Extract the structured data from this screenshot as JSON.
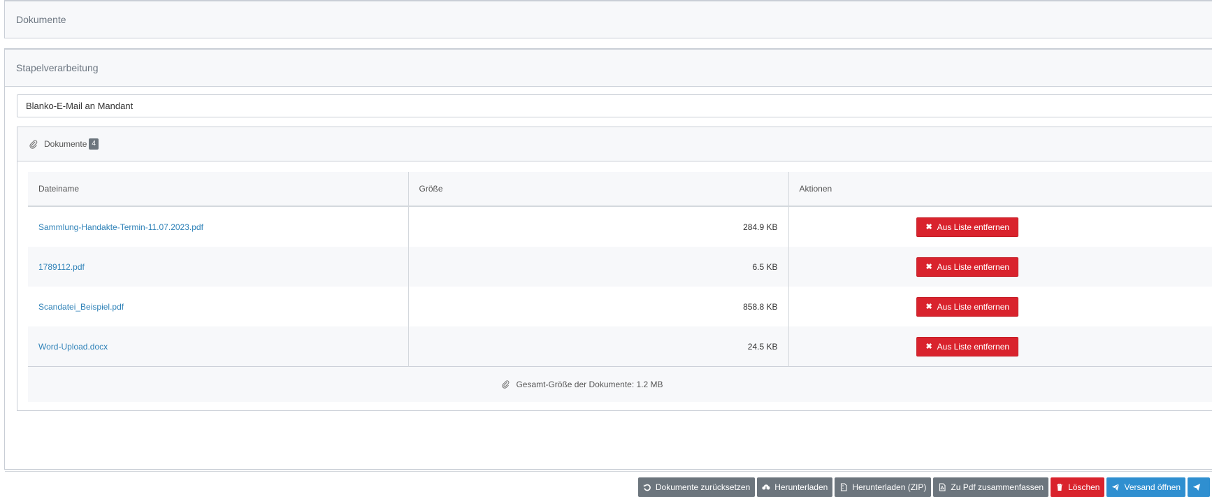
{
  "top_panel": {
    "title": "Dokumente"
  },
  "batch_panel": {
    "title": "Stapelverarbeitung",
    "template_select": {
      "selected": "Blanko-E-Mail an Mandant"
    },
    "documents": {
      "title": "Dokumente",
      "count": "4",
      "columns": [
        "Dateiname",
        "Größe",
        "Aktionen"
      ],
      "rows": [
        {
          "name": "Sammlung-Handakte-Termin-11.07.2023.pdf",
          "size": "284.9 KB",
          "action": "Aus Liste entfernen"
        },
        {
          "name": "1789112.pdf",
          "size": "6.5 KB",
          "action": "Aus Liste entfernen"
        },
        {
          "name": "Scandatei_Beispiel.pdf",
          "size": "858.8 KB",
          "action": "Aus Liste entfernen"
        },
        {
          "name": "Word-Upload.docx",
          "size": "24.5 KB",
          "action": "Aus Liste entfernen"
        }
      ],
      "total": "Gesamt-Größe der Dokumente: 1.2 MB"
    },
    "footer_buttons": {
      "reset": "Dokumente zurücksetzen",
      "download": "Herunterladen",
      "download_zip": "Herunterladen (ZIP)",
      "merge_pdf": "Zu Pdf zusammenfassen",
      "delete": "Löschen",
      "open_dispatch": "Versand öffnen"
    }
  },
  "colors": {
    "danger": "#d9232d",
    "primary": "#2f8fd0",
    "secondary": "#6c757d",
    "link": "#2f82b8"
  }
}
